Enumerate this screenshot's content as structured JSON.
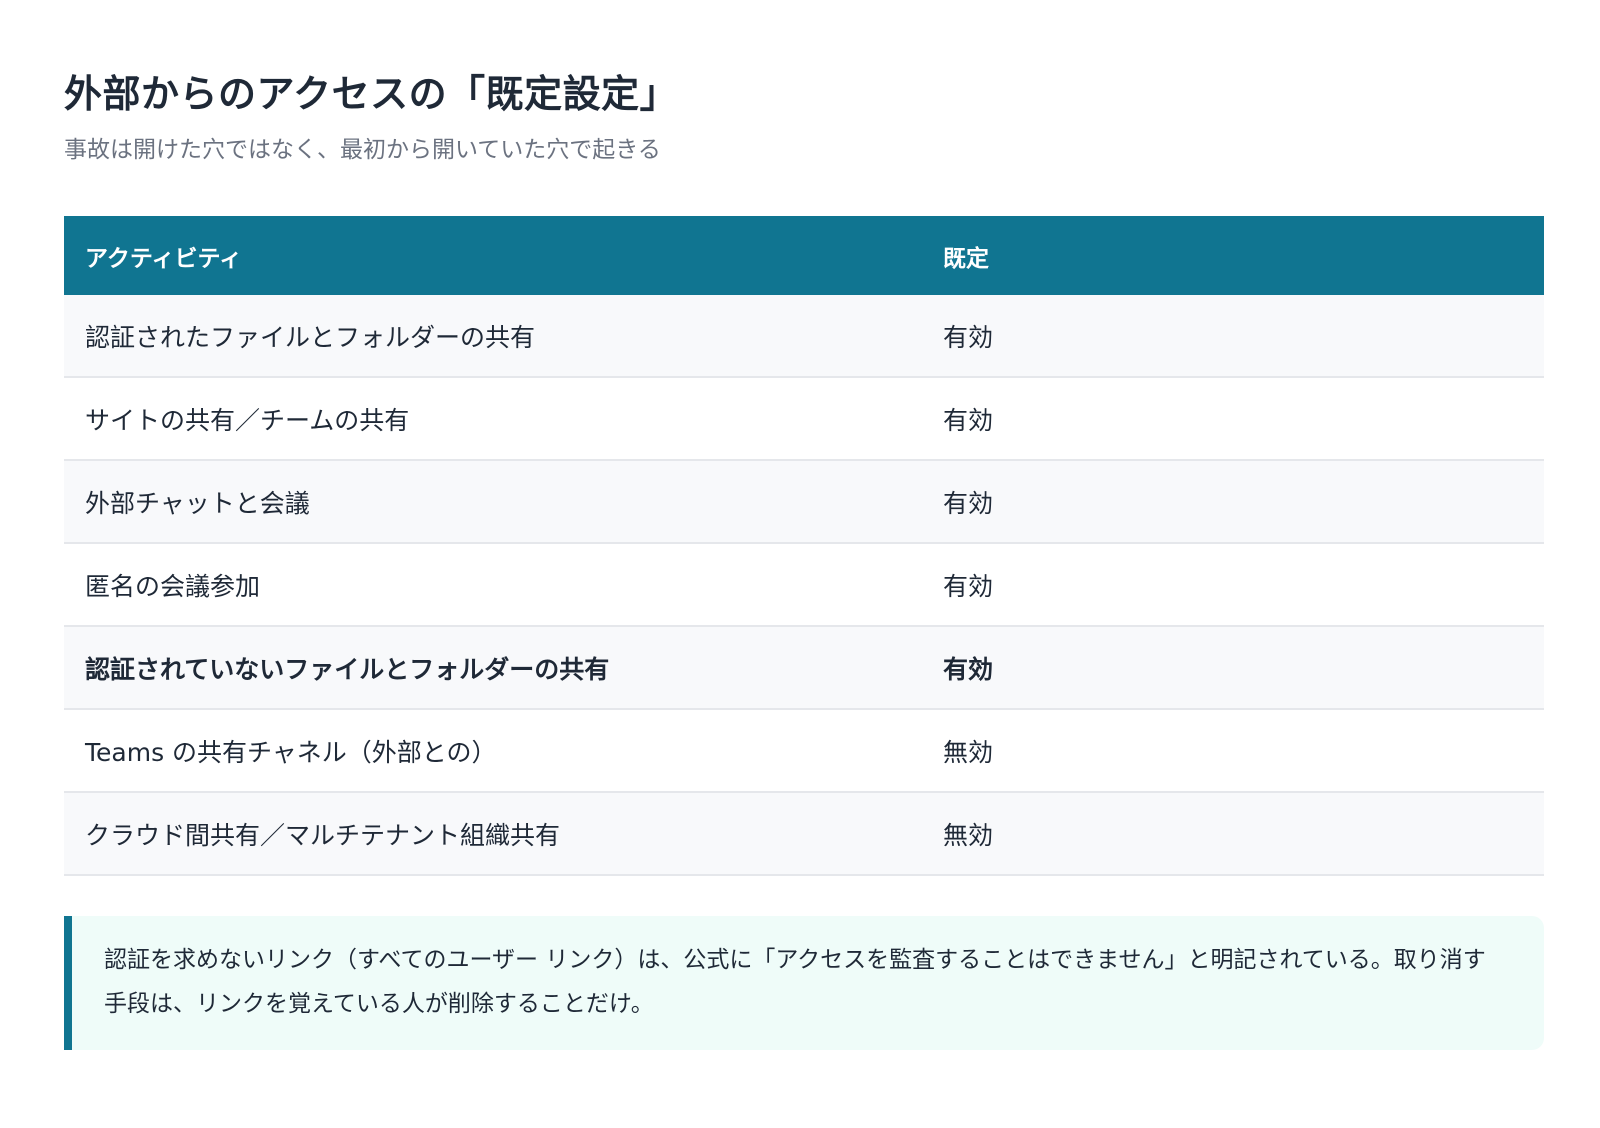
{
  "page": {
    "title": "外部からのアクセスの「既定設定」",
    "subtitle": "事故は開けた穴ではなく、最初から開いていた穴で起きる"
  },
  "table": {
    "headers": [
      "アクティビティ",
      "既定"
    ],
    "rows": [
      {
        "activity": "認証されたファイルとフォルダーの共有",
        "default": "有効",
        "emphasis": false
      },
      {
        "activity": "サイトの共有／チームの共有",
        "default": "有効",
        "emphasis": false
      },
      {
        "activity": "外部チャットと会議",
        "default": "有効",
        "emphasis": false
      },
      {
        "activity": "匿名の会議参加",
        "default": "有効",
        "emphasis": false
      },
      {
        "activity": "認証されていないファイルとフォルダーの共有",
        "default": "有効",
        "emphasis": true
      },
      {
        "activity": "Teams の共有チャネル（外部との）",
        "default": "無効",
        "emphasis": false
      },
      {
        "activity": "クラウド間共有／マルチテナント組織共有",
        "default": "無効",
        "emphasis": false
      }
    ]
  },
  "callout": {
    "text": "認証を求めないリンク（すべてのユーザー リンク）は、公式に「アクセスを監査することはできません」と明記されている。取り消す手段は、リンクを覚えている人が削除することだけ。"
  },
  "colors": {
    "header_bg": "#107591",
    "callout_bg": "#effcf9",
    "callout_border": "#107591"
  }
}
